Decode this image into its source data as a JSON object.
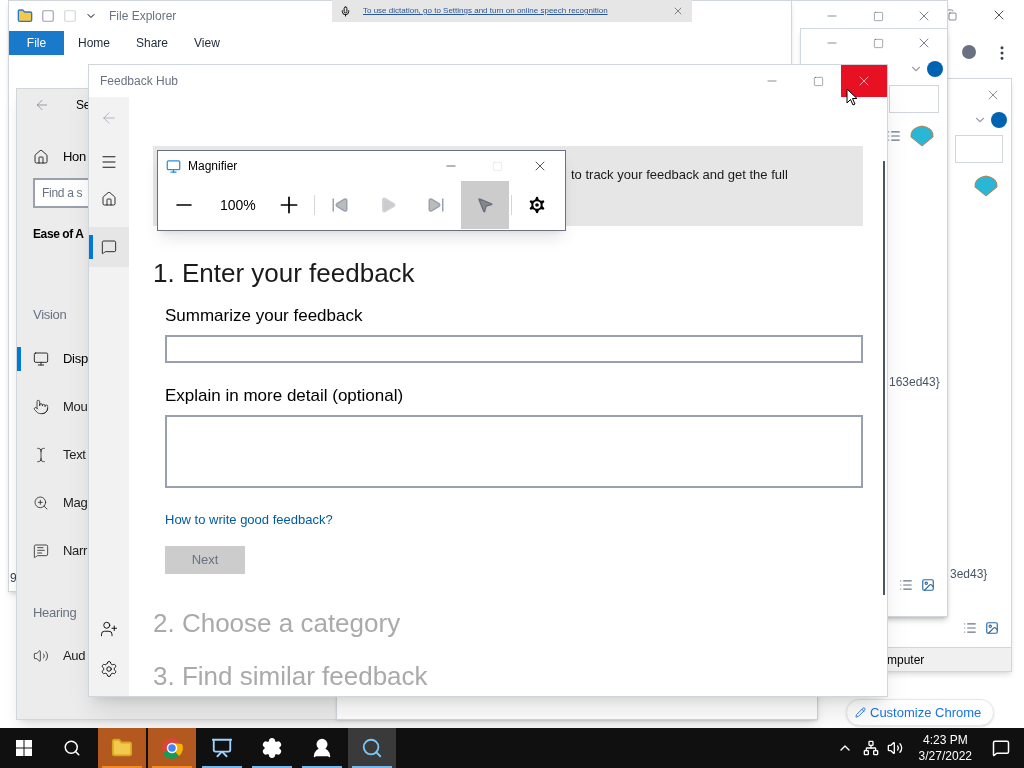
{
  "file_explorer": {
    "title": "File Explorer",
    "ribbon_tabs": [
      {
        "label": "File",
        "selected": true
      },
      {
        "label": "Home",
        "selected": false
      },
      {
        "label": "Share",
        "selected": false
      },
      {
        "label": "View",
        "selected": false
      }
    ],
    "status": "9"
  },
  "dictation_toast": {
    "text": "To use dictation, go to Settings and turn on online speech recognition"
  },
  "background_explorers": [
    {
      "text": "163ed43}"
    },
    {
      "text": "3ed43}"
    },
    {
      "text": "mputer"
    }
  ],
  "chrome": {
    "link": "Customize Chrome"
  },
  "settings": {
    "title": "Se",
    "home": "Hon",
    "search_placeholder": "Find a s",
    "heading": "Ease of A",
    "groups": [
      {
        "label": "Vision",
        "items": [
          {
            "label": "Disp",
            "selected": true
          },
          {
            "label": "Mou",
            "selected": false
          },
          {
            "label": "Text",
            "selected": false
          },
          {
            "label": "Mag",
            "selected": false
          },
          {
            "label": "Narr",
            "selected": false
          }
        ]
      },
      {
        "label": "Hearing",
        "items": [
          {
            "label": "Aud",
            "selected": false
          }
        ]
      }
    ]
  },
  "feedback_hub": {
    "title": "Feedback Hub",
    "nav": [
      {
        "selected": false
      },
      {
        "selected": true
      }
    ],
    "banner": "to track your feedback and get the full",
    "section_title": "1. Enter your feedback",
    "summary_label": "Summarize your feedback",
    "detail_label": "Explain in more detail (optional)",
    "help_link": "How to write good feedback?",
    "next_button": {
      "label": "Next",
      "disabled": true
    },
    "later_sections": [
      "2. Choose a category",
      "3. Find similar feedback"
    ]
  },
  "magnifier": {
    "title": "Magnifier",
    "zoom": "100%",
    "read_from_pointer_selected": true
  },
  "taskbar": {
    "apps": [
      {
        "flashing": true,
        "selected": false
      },
      {
        "flashing": true,
        "selected": false
      },
      {
        "flashing": false,
        "selected": false
      },
      {
        "flashing": false,
        "selected": false
      },
      {
        "flashing": false,
        "selected": false
      },
      {
        "flashing": false,
        "selected": true
      }
    ],
    "time": "4:23 PM",
    "date": "3/27/2022"
  }
}
